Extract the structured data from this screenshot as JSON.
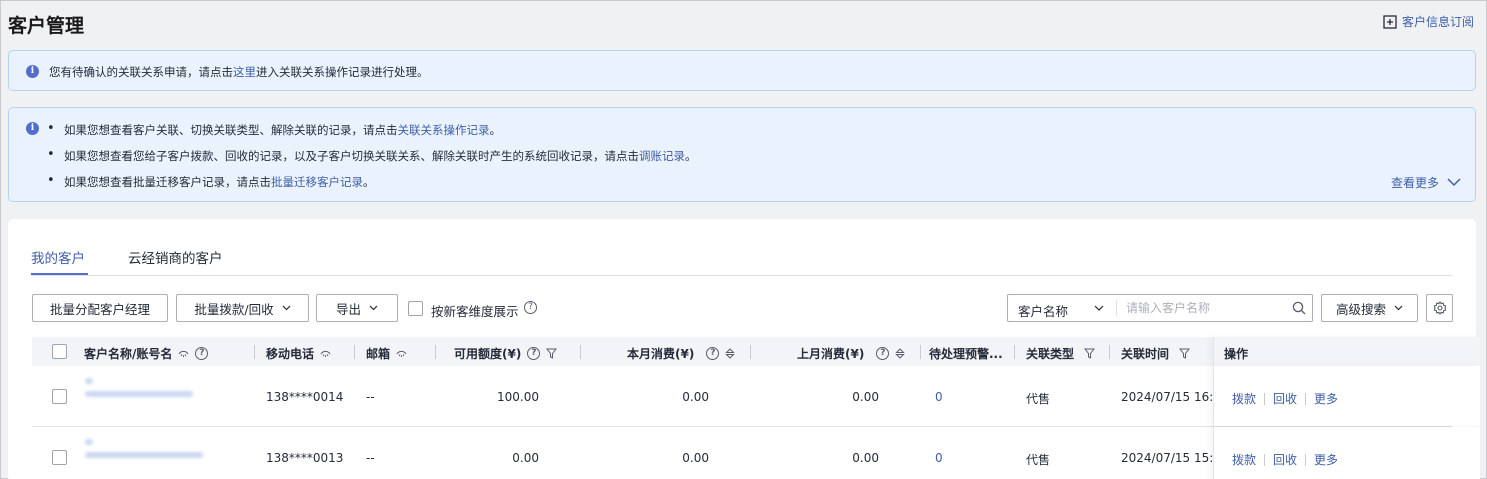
{
  "header": {
    "title": "客户管理",
    "subscribe_label": "客户信息订阅"
  },
  "notice1": {
    "text_before": "您有待确认的关联关系申请，请点击",
    "link": "这里",
    "text_after": "进入关联关系操作记录进行处理。"
  },
  "notice2": {
    "lines": [
      {
        "before": "如果您想查看客户关联、切换关联类型、解除关联的记录，请点击",
        "link": "关联关系操作记录",
        "after": "。"
      },
      {
        "before": "如果您想查看您给子客户拨款、回收的记录，以及子客户切换关联关系、解除关联时产生的系统回收记录，请点击",
        "link": "调账记录",
        "after": "。"
      },
      {
        "before": "如果您想查看批量迁移客户记录，请点击",
        "link": "批量迁移客户记录",
        "after": "。"
      }
    ],
    "more_label": "查看更多"
  },
  "tabs": [
    {
      "label": "我的客户"
    },
    {
      "label": "云经销商的客户"
    }
  ],
  "toolbar": {
    "batch_assign": "批量分配客户经理",
    "batch_fund": "批量拨款/回收",
    "export": "导出",
    "toggle_label": "按新客维度展示",
    "search_type": "客户名称",
    "search_placeholder": "请输入客户名称",
    "advanced_search": "高级搜索"
  },
  "table": {
    "columns": {
      "name": "客户名称/账号名",
      "mobile": "移动电话",
      "email": "邮箱",
      "credit": "可用额度(¥)",
      "this_month": "本月消费(¥)",
      "last_month": "上月消费(¥)",
      "pending": "待处理预警...",
      "type": "关联类型",
      "time": "关联时间",
      "ops": "操作"
    },
    "rows": [
      {
        "mobile": "138****0014",
        "email": "--",
        "credit": "100.00",
        "this_month": "0.00",
        "last_month": "0.00",
        "pending": "0",
        "type": "代售",
        "time": "2024/07/15 16:03:",
        "ops": [
          "拨款",
          "回收",
          "更多"
        ]
      },
      {
        "mobile": "138****0013",
        "email": "--",
        "credit": "0.00",
        "this_month": "0.00",
        "last_month": "0.00",
        "pending": "0",
        "type": "代售",
        "time": "2024/07/15 15:58:",
        "ops": [
          "拨款",
          "回收",
          "更多"
        ]
      }
    ]
  },
  "colors": {
    "accent": "#526ecc",
    "link": "#3e5ea8",
    "notice_bg": "#eaf3fd"
  }
}
